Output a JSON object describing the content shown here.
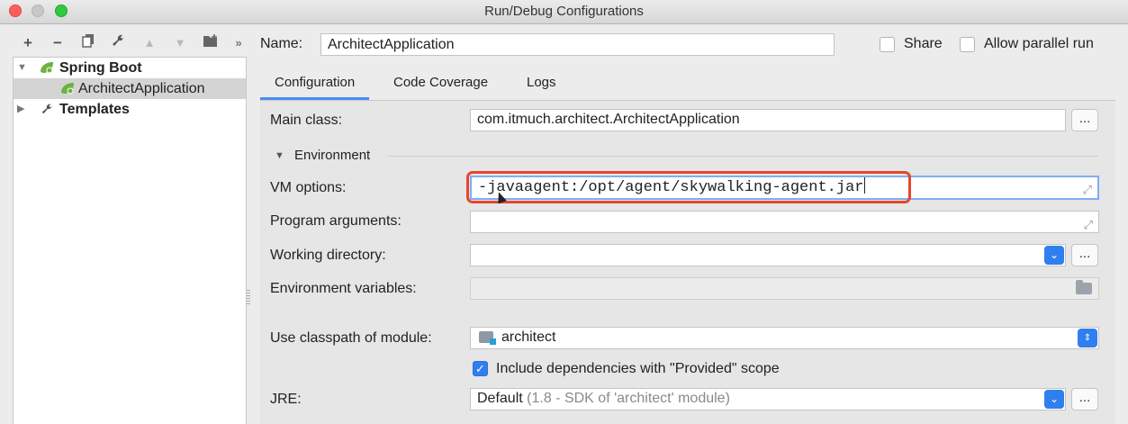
{
  "window": {
    "title": "Run/Debug Configurations"
  },
  "toolbar": {
    "icons": [
      "plus-icon",
      "minus-icon",
      "copy-icon",
      "wrench-icon",
      "up-arrow-icon",
      "down-arrow-icon",
      "folder-add-icon",
      "more-icon"
    ]
  },
  "tree": {
    "group": "Spring Boot",
    "child": "ArchitectApplication",
    "templates": "Templates"
  },
  "header": {
    "name_label": "Name:",
    "name_value": "ArchitectApplication",
    "share_label": "Share",
    "parallel_label": "Allow parallel run"
  },
  "tabs": [
    "Configuration",
    "Code Coverage",
    "Logs"
  ],
  "form": {
    "main_class_label": "Main class:",
    "main_class_value": "com.itmuch.architect.ArchitectApplication",
    "environment_label": "Environment",
    "vm_options_label": "VM options:",
    "vm_options_value": "-javaagent:/opt/agent/skywalking-agent.jar",
    "program_args_label": "Program arguments:",
    "working_dir_label": "Working directory:",
    "env_vars_label": "Environment variables:",
    "classpath_label": "Use classpath of module:",
    "classpath_value": "architect",
    "include_deps_label": "Include dependencies with \"Provided\" scope",
    "jre_label": "JRE:",
    "jre_value": "Default",
    "jre_detail": "(1.8 - SDK of 'architect' module)",
    "dots": "..."
  },
  "colors": {
    "accent": "#2f7ff0",
    "highlight": "#e5472c",
    "spring": "#6db33f"
  }
}
